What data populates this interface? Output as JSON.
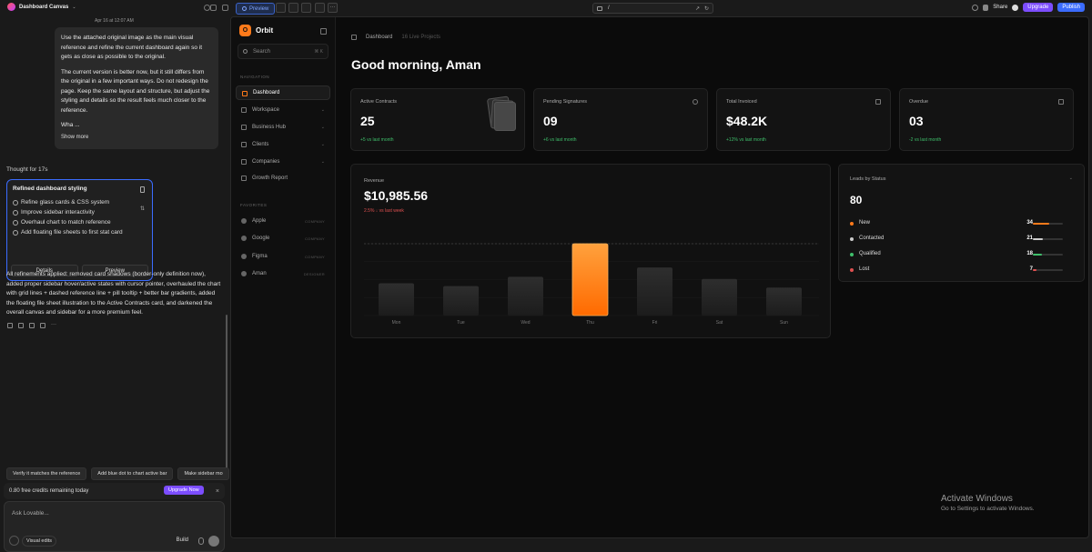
{
  "topbar": {
    "project": "Dashboard Canvas",
    "preview_label": "Preview",
    "url": "/",
    "share": "Share",
    "upgrade": "Upgrade",
    "publish": "Publish"
  },
  "chat": {
    "timestamp": "Apr 16 at 12:07 AM",
    "user_message": [
      "Use the attached original image as the main visual reference and refine the current dashboard again so it gets as close as possible to the original.",
      "The current version is better now, but it still differs from the original in a few important ways. Do not redesign the page. Keep the same layout and structure, but adjust the styling and details so the result feels much closer to the reference.",
      "Wha ..."
    ],
    "show_more": "Show more",
    "thought": "Thought for 17s",
    "card_title": "Refined dashboard styling",
    "tasks": [
      "Refine glass cards & CSS system",
      "Improve sidebar interactivity",
      "Overhaul chart to match reference",
      "Add floating file sheets to first stat card"
    ],
    "details_btn": "Details",
    "preview_btn": "Preview",
    "summary": "All refinements applied: removed card shadows (border-only definition now), added proper sidebar hover/active states with cursor pointer, overhauled the chart with grid lines + dashed reference line + pill tooltip + better bar gradients, added the floating file sheet illustration to the Active Contracts card, and darkened the overall canvas and sidebar for a more premium feel.",
    "suggestions": [
      "Verify it matches the reference",
      "Add blue dot to chart active bar",
      "Make sidebar mo"
    ],
    "credits": "0.80 free credits remaining today",
    "upgrade_now": "Upgrade Now",
    "input_placeholder": "Ask Lovable...",
    "visual_edits": "Visual edits",
    "build": "Build"
  },
  "app": {
    "brand": "Orbit",
    "brand_initial": "O",
    "search_placeholder": "Search",
    "search_kbd": "⌘ K",
    "nav_label": "NAVIGATION",
    "nav": [
      {
        "label": "Dashboard",
        "chev": ""
      },
      {
        "label": "Workspace",
        "chev": "⌄"
      },
      {
        "label": "Business Hub",
        "chev": "⌄"
      },
      {
        "label": "Clients",
        "chev": "⌄"
      },
      {
        "label": "Companies",
        "chev": "⌄"
      },
      {
        "label": "Growth Report",
        "chev": ""
      }
    ],
    "fav_label": "FAVORITES",
    "favorites": [
      {
        "label": "Apple",
        "tag": "COMPANY"
      },
      {
        "label": "Google",
        "tag": "COMPANY"
      },
      {
        "label": "Figma",
        "tag": "COMPANY"
      },
      {
        "label": "Aman",
        "tag": "DESIGNER"
      }
    ],
    "breadcrumb": "Dashboard",
    "breadcrumb_sub": "16 Live Projects",
    "greeting": "Good morning, Aman",
    "stats": [
      {
        "label": "Active Contracts",
        "value": "25",
        "change": "+5 vs last month"
      },
      {
        "label": "Pending Signatures",
        "value": "09",
        "change": "+6 vs last month"
      },
      {
        "label": "Total Invoiced",
        "value": "$48.2K",
        "change": "+12% vs last month"
      },
      {
        "label": "Overdue",
        "value": "03",
        "change": "-2 vs last month"
      }
    ],
    "revenue": {
      "label": "Revenue",
      "value": "$10,985.56",
      "change": "2.5% ↓ vs last week"
    },
    "leads": {
      "label": "Leads by Status",
      "total": "80",
      "rows": [
        {
          "name": "New",
          "count": "34",
          "color": "#ff7a1a"
        },
        {
          "name": "Contacted",
          "count": "21",
          "color": "#cccccc"
        },
        {
          "name": "Qualified",
          "count": "18",
          "color": "#3fbf6b"
        },
        {
          "name": "Lost",
          "count": "7",
          "color": "#e05050"
        }
      ]
    }
  },
  "chart_data": {
    "type": "bar",
    "categories": [
      "Mon",
      "Tue",
      "Wed",
      "Thu",
      "Fri",
      "Sat",
      "Sun"
    ],
    "values": [
      45,
      41,
      54,
      100,
      67,
      51,
      39
    ],
    "highlight_index": 3,
    "ylim": [
      0,
      100
    ],
    "grid": true,
    "reference_line": 100
  },
  "watermark": {
    "line1": "Activate Windows",
    "line2": "Go to Settings to activate Windows."
  }
}
